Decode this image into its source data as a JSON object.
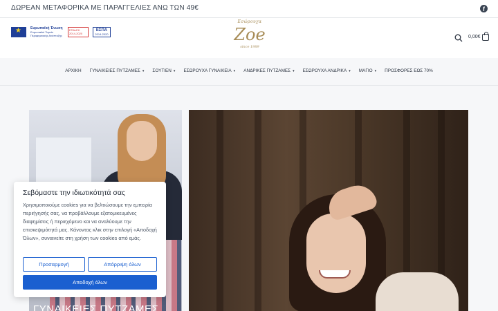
{
  "topbar": {
    "promo": "ΔΩΡΕΑΝ ΜΕΤΑΦΟΡΙΚΑ ΜΕ ΠΑΡΑΓΓΕΛΙΕΣ ΑΝΩ ΤΩΝ 49€",
    "facebook_icon": "facebook-icon"
  },
  "header": {
    "eu_logo_title": "Ευρωπαϊκή Ένωση",
    "eu_logo_subtitle": "Ευρωπαϊκό Ταμείο Περιφερειακής Ανάπτυξης",
    "espa_left": "ΕΠΑνΕΚ 2014-2020",
    "espa_right_title": "ΕΣΠΑ",
    "espa_right_years": "2014-2020",
    "logo_top": "Εσώρουχα",
    "logo_main": "Zoe",
    "logo_sub": "since 1989",
    "cart_total": "0,00€",
    "search_icon": "search-icon",
    "cart_icon": "cart-icon"
  },
  "nav": {
    "items": [
      {
        "label": "ΑΡΧΙΚΗ",
        "dropdown": false
      },
      {
        "label": "ΓΥΝΑΙΚΕΙΕΣ ΠΥΤΖΑΜΕΣ",
        "dropdown": true
      },
      {
        "label": "ΣΟΥΤΙΕΝ",
        "dropdown": true
      },
      {
        "label": "ΕΣΩΡΟΥΧΑ ΓΥΝΑΙΚΕΙΑ",
        "dropdown": true
      },
      {
        "label": "ΑΝΔΡΙΚΕΣ ΠΥΤΖΑΜΕΣ",
        "dropdown": true
      },
      {
        "label": "ΕΣΩΡΟΥΧΑ ΑΝΔΡΙΚΑ",
        "dropdown": true
      },
      {
        "label": "ΜΑΓΙΟ",
        "dropdown": true
      },
      {
        "label": "ΠΡΟΣΦΟΡΕΣ ΕΩΣ 70%",
        "dropdown": false
      }
    ]
  },
  "hero": {
    "left_caption": "ΓΥΝΑΙΚΕΙΕΣ ΠΥΤΖΑΜΕΣ"
  },
  "cookie": {
    "title": "Σεβόμαστε την ιδιωτικότητά σας",
    "body": "Χρησιμοποιούμε cookies για να βελτιώσουμε την εμπειρία περιήγησής σας, να προβάλλουμε εξατομικευμένες διαφημίσεις ή περιεχόμενο και να αναλύουμε την επισκεψιμότητά μας. Κάνοντας κλικ στην επιλογή «Αποδοχή Όλων», συναινείτε στη χρήση των cookies από εμάς.",
    "customize_label": "Προσαρμογή",
    "reject_label": "Απόρριψη όλων",
    "accept_label": "Αποδοχή όλων"
  },
  "colors": {
    "accent": "#1a5fd0",
    "logo_gold": "#a88d58",
    "text_dark": "#2b3340"
  }
}
